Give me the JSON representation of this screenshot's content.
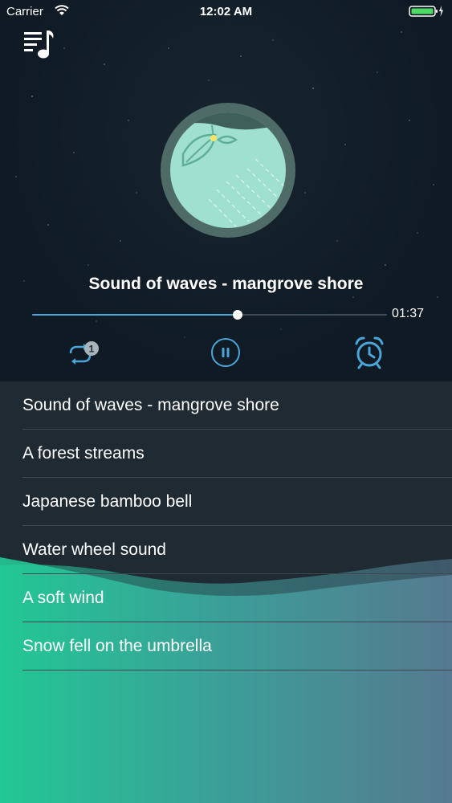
{
  "status_bar": {
    "carrier": "Carrier",
    "time": "12:02 AM"
  },
  "player": {
    "track_title": "Sound of waves - mangrove shore",
    "elapsed": "01:37",
    "progress": 0.58,
    "repeat_badge": "1",
    "accent_color": "#4aa6d8"
  },
  "icons": {
    "playlist": "playlist-music-icon",
    "repeat": "repeat-icon",
    "pause": "pause-icon",
    "alarm": "alarm-clock-icon"
  },
  "tracks": [
    "Sound of waves - mangrove shore",
    "A forest streams",
    "Japanese bamboo bell",
    "Water wheel sound",
    "A soft wind",
    "Snow fell on the umbrella"
  ]
}
